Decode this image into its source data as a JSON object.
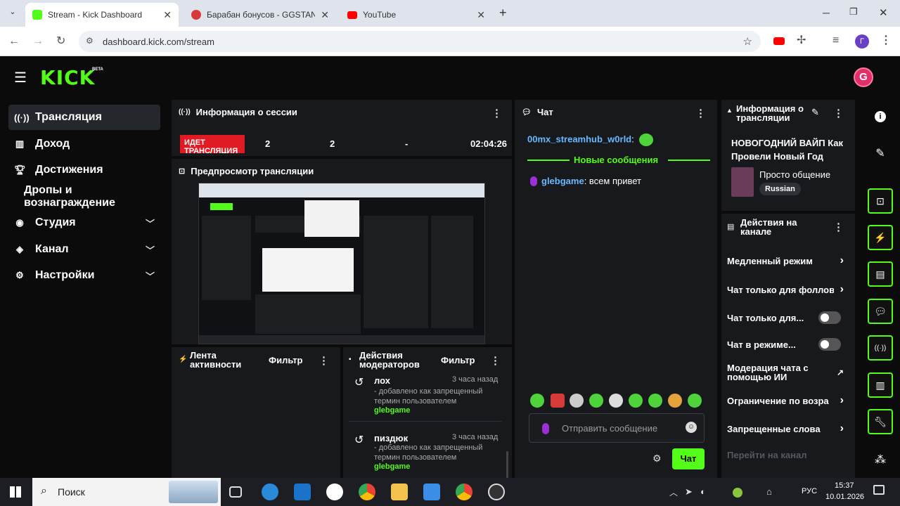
{
  "browser": {
    "tabs": [
      {
        "title": "Stream - Kick Dashboard",
        "active": true,
        "color": "#53fc18"
      },
      {
        "title": "Барабан бонусов - GGSTANDO",
        "active": false,
        "color": "#d83a3a"
      },
      {
        "title": "YouTube",
        "active": false,
        "color": "#ff0000"
      }
    ],
    "new_tab": "+",
    "url": "dashboard.kick.com/stream",
    "profile_letter": "Г"
  },
  "app": {
    "logo": "KICK",
    "beta": "BETA",
    "accent": "#53fc18"
  },
  "sidebar": {
    "items": [
      {
        "label": "Трансляция",
        "icon": "broadcast-icon",
        "active": true
      },
      {
        "label": "Доход",
        "icon": "revenue-icon"
      },
      {
        "label": "Достижения",
        "icon": "trophy-icon"
      },
      {
        "label": "Дропы и вознаграждение",
        "icon": ""
      },
      {
        "label": "Студия",
        "icon": "studio-icon",
        "expandable": true
      },
      {
        "label": "Канал",
        "icon": "channel-icon",
        "expandable": true
      },
      {
        "label": "Настройки",
        "icon": "gear-icon",
        "expandable": true
      }
    ]
  },
  "session": {
    "title": "Информация о сессии",
    "live_badge": "ИДЕТ ТРАНСЛЯЦИЯ",
    "viewers": "2",
    "followers": "2",
    "dash": "-",
    "duration": "02:04:26"
  },
  "preview": {
    "title": "Предпросмотр трансляции"
  },
  "activity": {
    "title": "Лента активности",
    "filter": "Фильтр"
  },
  "mod_actions": {
    "title": "Действия модераторов",
    "filter": "Фильтр",
    "entries": [
      {
        "term": "лох",
        "time": "3 часа назад",
        "desc": "- добавлено как запрещенный термин пользователем",
        "user": "glebgame"
      },
      {
        "term": "пиздюк",
        "time": "3 часа назад",
        "desc": "- добавлено как запрещенный термин пользователем",
        "user": "glebgame"
      }
    ]
  },
  "chat": {
    "title": "Чат",
    "messages_top": [
      {
        "user": "00mx_streamhub_w0rld",
        "text": ":"
      }
    ],
    "new_messages": "Новые сообщения",
    "messages": [
      {
        "user": "glebgame",
        "text": ": всем привет"
      }
    ],
    "input_placeholder": "Отправить сообщение",
    "send": "Чат"
  },
  "stream_info": {
    "title": "Информация о трансляции",
    "stream_title": "НОВОГОДНИЙ ВАЙП Как Провели Новый Год",
    "category": "Просто общение",
    "language": "Russian"
  },
  "channel_actions": {
    "title": "Действия на канале",
    "items": [
      {
        "label": "Медленный режим",
        "control": "arrow"
      },
      {
        "label": "Чат только для фоллов",
        "control": "arrow"
      },
      {
        "label": "Чат только для...",
        "control": "toggle"
      },
      {
        "label": "Чат в режиме...",
        "control": "toggle"
      },
      {
        "label": "Модерация чата с помощью ИИ",
        "control": "external"
      },
      {
        "label": "Ограничение по возра",
        "control": "arrow"
      },
      {
        "label": "Запрещенные слова",
        "control": "arrow"
      }
    ],
    "go_to_channel": "Перейти на канал"
  },
  "taskbar": {
    "search": "Поиск",
    "lang": "РУС",
    "time": "15:37",
    "date": "10.01.2026"
  }
}
